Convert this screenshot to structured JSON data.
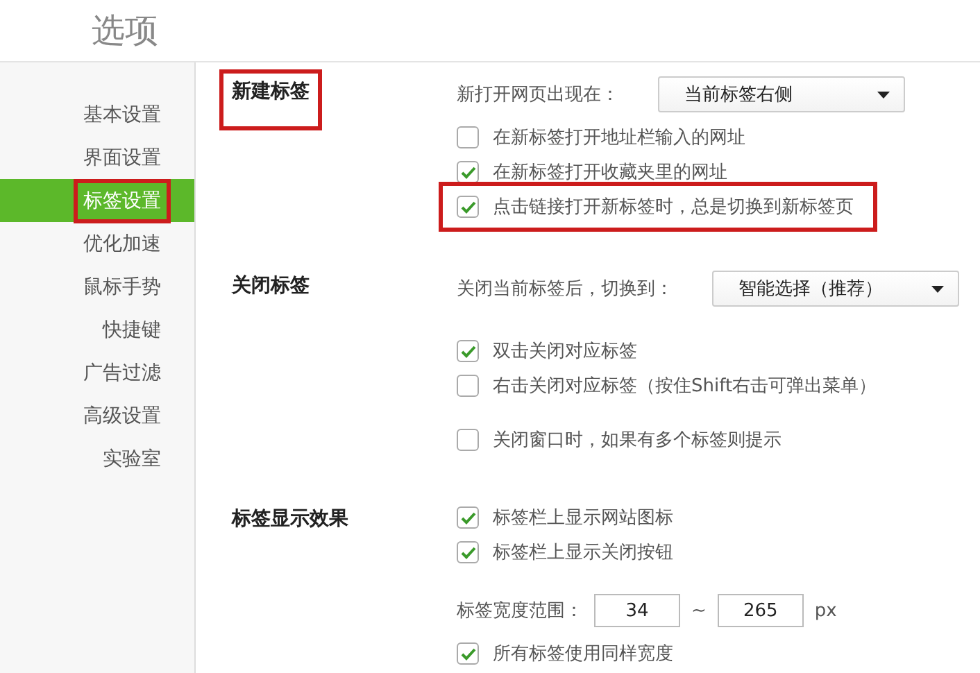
{
  "title": "选项",
  "sidebar": {
    "items": [
      {
        "label": "基本设置",
        "selected": false,
        "highlighted": false
      },
      {
        "label": "界面设置",
        "selected": false,
        "highlighted": false
      },
      {
        "label": "标签设置",
        "selected": true,
        "highlighted": true
      },
      {
        "label": "优化加速",
        "selected": false,
        "highlighted": false
      },
      {
        "label": "鼠标手势",
        "selected": false,
        "highlighted": false
      },
      {
        "label": "快捷键",
        "selected": false,
        "highlighted": false
      },
      {
        "label": "广告过滤",
        "selected": false,
        "highlighted": false
      },
      {
        "label": "高级设置",
        "selected": false,
        "highlighted": false
      },
      {
        "label": "实验室",
        "selected": false,
        "highlighted": false
      }
    ]
  },
  "sections": [
    {
      "heading": "新建标签",
      "highlighted": true,
      "groups": [
        [
          {
            "kind": "select",
            "label": "新打开网页出现在：",
            "value": "当前标签右侧"
          },
          {
            "kind": "checkbox",
            "label": "在新标签打开地址栏输入的网址",
            "checked": false,
            "highlighted": false
          },
          {
            "kind": "checkbox",
            "label": "在新标签打开收藏夹里的网址",
            "checked": true,
            "highlighted": false
          },
          {
            "kind": "checkbox",
            "label": "点击链接打开新标签时，总是切换到新标签页",
            "checked": true,
            "highlighted": true
          }
        ]
      ]
    },
    {
      "heading": "关闭标签",
      "highlighted": false,
      "groups": [
        [
          {
            "kind": "select",
            "label": "关闭当前标签后，切换到：",
            "value": "智能选择（推荐）"
          }
        ],
        [
          {
            "kind": "checkbox",
            "label": "双击关闭对应标签",
            "checked": true,
            "highlighted": false
          },
          {
            "kind": "checkbox",
            "label": "右击关闭对应标签（按住Shift右击可弹出菜单）",
            "checked": false,
            "highlighted": false
          }
        ],
        [
          {
            "kind": "checkbox",
            "label": "关闭窗口时，如果有多个标签则提示",
            "checked": false,
            "highlighted": false
          }
        ]
      ]
    },
    {
      "heading": "标签显示效果",
      "highlighted": false,
      "groups": [
        [
          {
            "kind": "checkbox",
            "label": "标签栏上显示网站图标",
            "checked": true,
            "highlighted": false
          },
          {
            "kind": "checkbox",
            "label": "标签栏上显示关闭按钮",
            "checked": true,
            "highlighted": false
          }
        ],
        [
          {
            "kind": "range",
            "label": "标签宽度范围：",
            "min": "34",
            "separator": "~",
            "max": "265",
            "unit": "px"
          },
          {
            "kind": "checkbox",
            "label": "所有标签使用同样宽度",
            "checked": true,
            "highlighted": false
          }
        ]
      ]
    }
  ]
}
